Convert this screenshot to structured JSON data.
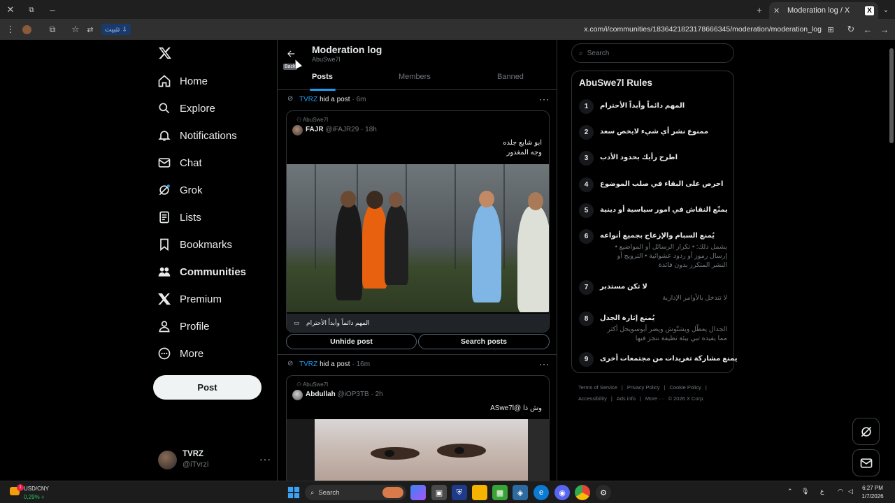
{
  "browser": {
    "tab_title": "Moderation log / X",
    "tab_favicon": "X",
    "install_label": "تثبيت",
    "url": "x.com/i/communities/1836421823178666345/moderation/moderation_log"
  },
  "nav": {
    "items": [
      {
        "label": "Home",
        "icon": "home-icon"
      },
      {
        "label": "Explore",
        "icon": "search-icon"
      },
      {
        "label": "Notifications",
        "icon": "bell-icon"
      },
      {
        "label": "Chat",
        "icon": "mail-icon"
      },
      {
        "label": "Grok",
        "icon": "grok-icon"
      },
      {
        "label": "Lists",
        "icon": "list-icon"
      },
      {
        "label": "Bookmarks",
        "icon": "bookmark-icon"
      },
      {
        "label": "Communities",
        "icon": "communities-icon"
      },
      {
        "label": "Premium",
        "icon": "x-icon"
      },
      {
        "label": "Profile",
        "icon": "person-icon"
      },
      {
        "label": "More",
        "icon": "more-circle-icon"
      }
    ],
    "post_label": "Post",
    "account": {
      "name": "TVRZ",
      "handle": "@iTvrzi"
    }
  },
  "header": {
    "title": "Moderation log",
    "subtitle": "AbuSwe7l",
    "back_tooltip": "Back"
  },
  "tabs": [
    "Posts",
    "Members",
    "Banned"
  ],
  "log": [
    {
      "moderator": "TVRZ",
      "action": "hid a post",
      "ago": "· 6m",
      "community": "AbuSwe7l",
      "author_name": "FAJR",
      "author_handle": "@iFAJR29 · 18h",
      "text_line1": "ابو شايع جلده",
      "text_line2": "وجه المغدور",
      "rule": "المهم دائماً وأبداً الأحترام",
      "unhide_label": "Unhide post",
      "search_label": "Search posts"
    },
    {
      "moderator": "TVRZ",
      "action": "hid a post",
      "ago": "· 16m",
      "community": "AbuSwe7l",
      "author_name": "Abdullah",
      "author_handle": "@iOP3TB · 2h",
      "text_line1": "وش ذا  @ASwe7l"
    }
  ],
  "right": {
    "search_placeholder": "Search",
    "rules_title": "AbuSwe7l Rules",
    "rules": [
      {
        "num": "1",
        "title": "المهم دائماً وأبداً الأحترام",
        "desc": ""
      },
      {
        "num": "2",
        "title": "ممنوع نشر أي شيء لايخص سعد",
        "desc": ""
      },
      {
        "num": "3",
        "title": "اطرح رأيك بحدود الأدب",
        "desc": ""
      },
      {
        "num": "4",
        "title": "احرص على البقاء في صلب الموضوع",
        "desc": ""
      },
      {
        "num": "5",
        "title": "يمنّع النقاش في امور سياسية أو دينية",
        "desc": ""
      },
      {
        "num": "6",
        "title": "يُمنع السبام والإزعاج بجميع أنواعه",
        "desc": "يشمل ذلك: • تكرار الرسائل أو المواضيع • إرسال رموز أو ردود عشوائية • الترويج أو النشر المتكرر بدون فائدة"
      },
      {
        "num": "7",
        "title": "لا تكن مستدبر",
        "desc": "لا تتدخل بالأوامر الإدارية"
      },
      {
        "num": "8",
        "title": "يُمنع إثارة الجدل",
        "desc": "الجدال يعطّل ويشتّوش ويضر أبوسويحل أكثر مما يفيده تبي بيئة نظيفة ننجز فيها"
      },
      {
        "num": "9",
        "title": "يمنع مشاركة تغريدات من مجتمعات أخرى",
        "desc": ""
      }
    ],
    "footer": [
      "Terms of Service",
      "|",
      "Privacy Policy",
      "|",
      "Cookie Policy",
      "|",
      "Accessibility",
      "|",
      "Ads info",
      "|",
      "More ···",
      "© 2026 X Corp."
    ]
  },
  "taskbar": {
    "ticker_name": "USD/CNY",
    "ticker_value": "0,29% +",
    "ticker_badge": "1",
    "search_label": "Search",
    "tray_lang": "ع",
    "time": "6:27 PM",
    "date": "1/7/2026"
  }
}
